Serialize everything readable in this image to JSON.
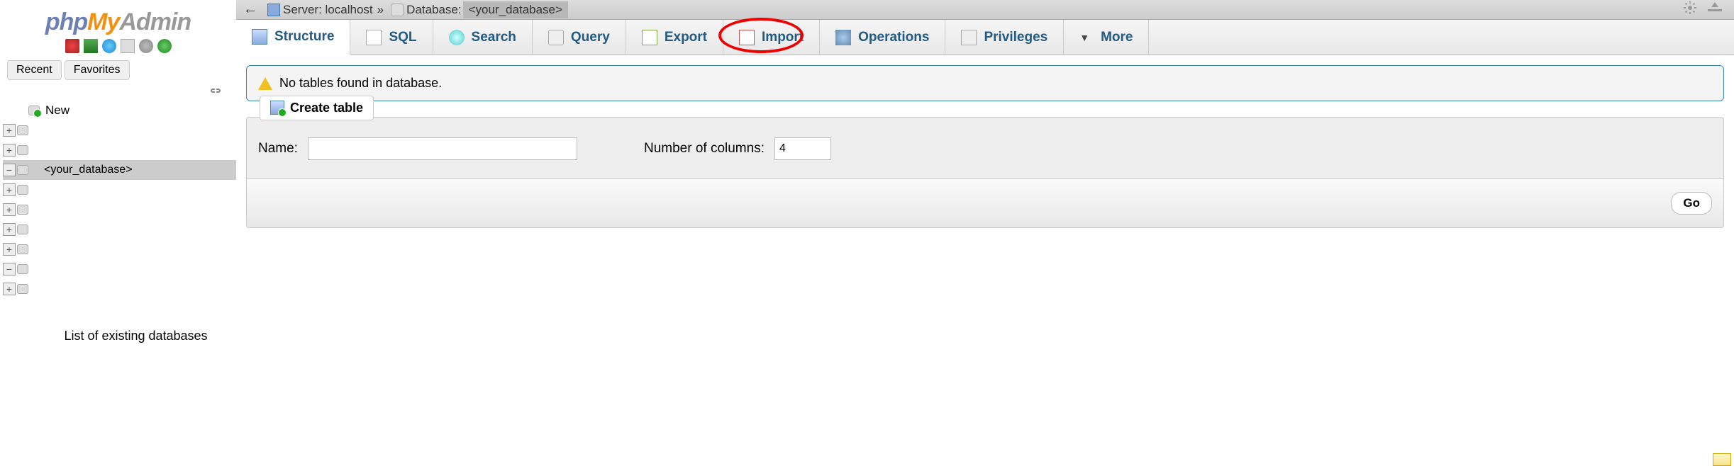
{
  "logo": {
    "part1": "php",
    "part2": "My",
    "part3": "Admin"
  },
  "recent_favorites": {
    "recent": "Recent",
    "favorites": "Favorites"
  },
  "tree": {
    "new_label": "New",
    "selected_db": "<your_database>",
    "list_label": "List of existing databases"
  },
  "breadcrumb": {
    "server_label": "Server:",
    "server_name": "localhost",
    "separator": "»",
    "database_label": "Database:",
    "database_name": "<your_database>"
  },
  "tabs": {
    "structure": "Structure",
    "sql": "SQL",
    "search": "Search",
    "query": "Query",
    "export": "Export",
    "import": "Import",
    "operations": "Operations",
    "privileges": "Privileges",
    "more": "More"
  },
  "notice": {
    "no_tables": "No tables found in database."
  },
  "create_table": {
    "legend": "Create table",
    "name_label": "Name:",
    "name_value": "",
    "num_cols_label": "Number of columns:",
    "num_cols_value": "4",
    "go_label": "Go"
  }
}
